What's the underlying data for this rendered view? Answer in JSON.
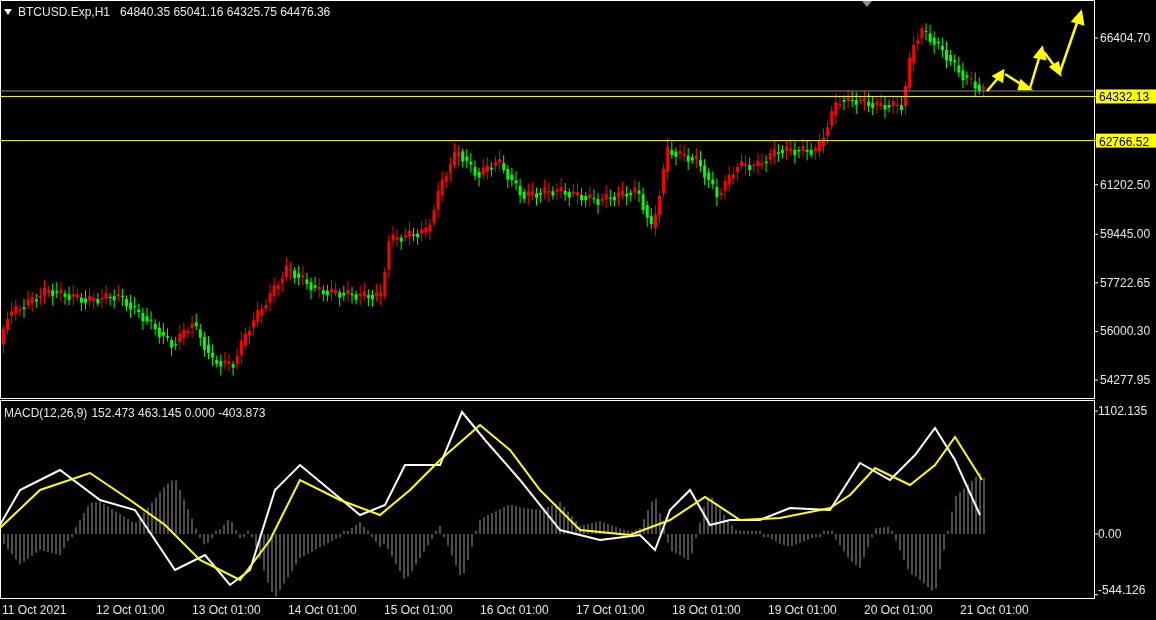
{
  "chart": {
    "symbol": "BTCUSD.Exp,H1",
    "ohlc": [
      "64840.35",
      "65041.16",
      "64325.75",
      "64476.36"
    ],
    "price_axis": [
      "66404.70",
      "61202.50",
      "59445.00",
      "57722.65",
      "56000.30",
      "54277.95"
    ],
    "level_tags": [
      {
        "label": "64332.13"
      },
      {
        "label": "62766.52"
      }
    ]
  },
  "macd": {
    "label": "MACD(12,26,9)",
    "values": [
      "152.473",
      "463.145",
      "0.000",
      "-403.873"
    ],
    "axis": [
      "1102.135",
      "0.00",
      "-544.126"
    ]
  },
  "time_axis": [
    "11 Oct 2021",
    "12 Oct 01:00",
    "13 Oct 01:00",
    "14 Oct 01:00",
    "15 Oct 01:00",
    "16 Oct 01:00",
    "17 Oct 01:00",
    "18 Oct 01:00",
    "19 Oct 01:00",
    "20 Oct 01:00",
    "21 Oct 01:00"
  ]
}
